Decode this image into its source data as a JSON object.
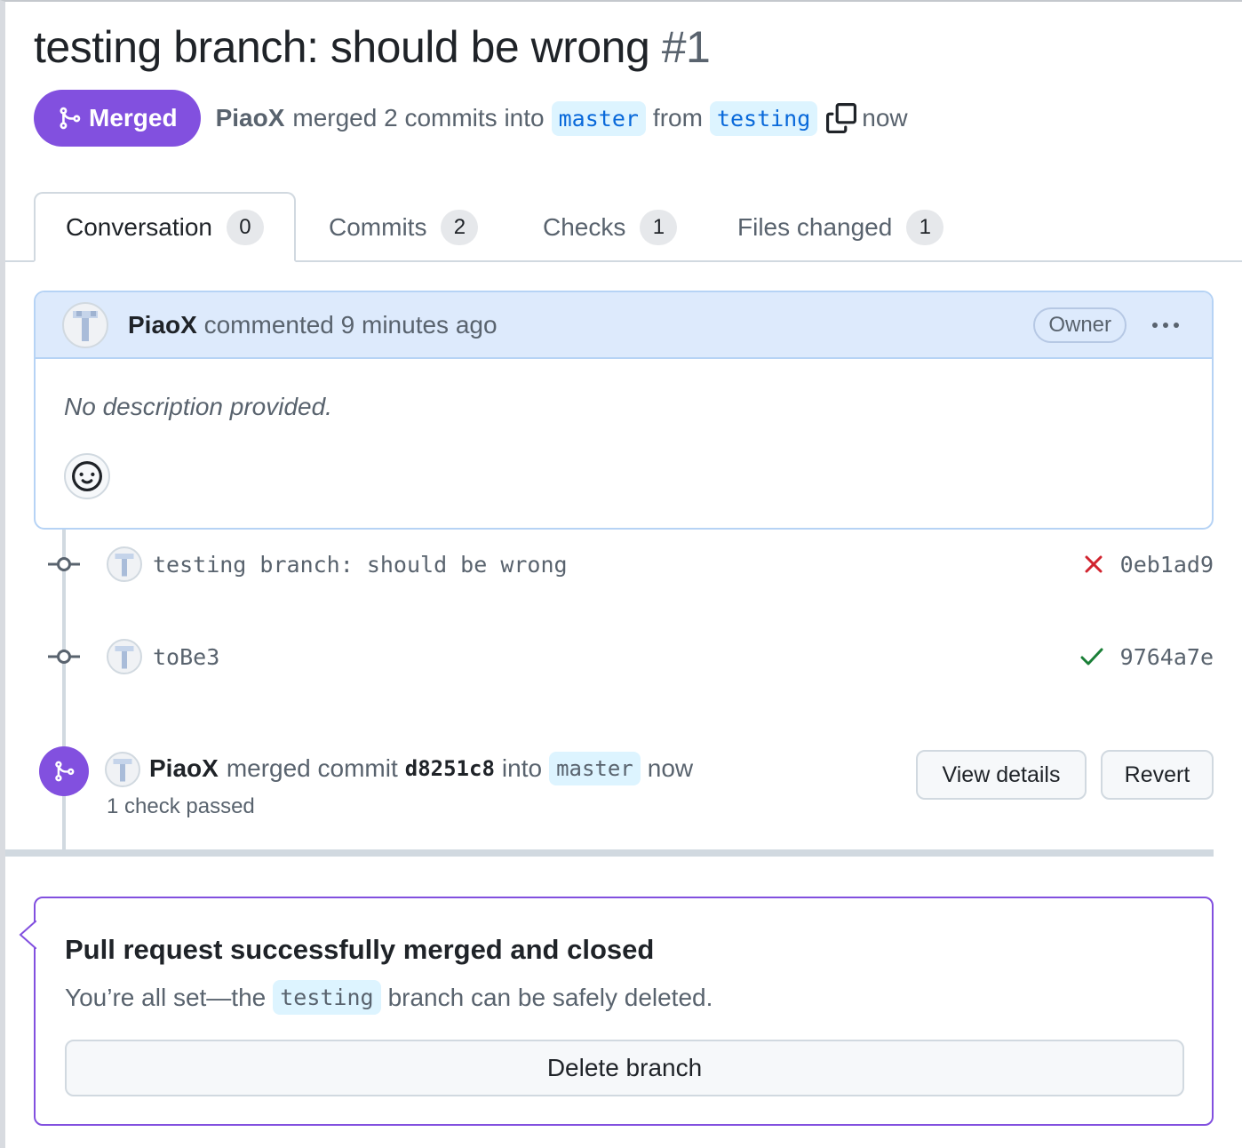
{
  "pr": {
    "title": "testing branch: should be wrong",
    "number": "#1",
    "state": "Merged",
    "author": "PiaoX",
    "merged_text": "merged 2 commits into",
    "base_branch": "master",
    "from_text": "from",
    "head_branch": "testing",
    "time": "now"
  },
  "tabs": [
    {
      "label": "Conversation",
      "count": "0"
    },
    {
      "label": "Commits",
      "count": "2"
    },
    {
      "label": "Checks",
      "count": "1"
    },
    {
      "label": "Files changed",
      "count": "1"
    }
  ],
  "comment": {
    "author": "PiaoX",
    "action": "commented 9 minutes ago",
    "badge": "Owner",
    "body": "No description provided."
  },
  "commits": [
    {
      "message": "testing branch: should be wrong",
      "sha": "0eb1ad9",
      "status": "failure"
    },
    {
      "message": "toBe3",
      "sha": "9764a7e",
      "status": "success"
    }
  ],
  "merge_event": {
    "author": "PiaoX",
    "action": "merged commit",
    "sha": "d8251c8",
    "into": "into",
    "branch": "master",
    "time": "now",
    "checks": "1 check passed",
    "view_details_label": "View details",
    "revert_label": "Revert"
  },
  "merged_panel": {
    "title": "Pull request successfully merged and closed",
    "sub_before": "You’re all set—the",
    "branch": "testing",
    "sub_after": "branch can be safely deleted.",
    "delete_label": "Delete branch"
  },
  "colors": {
    "merged_purple": "#8250df",
    "link_blue": "#0969da",
    "failure_red": "#d1242f",
    "success_green": "#1a7f37",
    "comment_header_bg": "#ddeafc"
  },
  "icons": [
    "git-merge-icon",
    "copy-icon",
    "kebab-horizontal-icon",
    "smiley-icon",
    "git-commit-icon",
    "x-icon",
    "check-icon"
  ]
}
